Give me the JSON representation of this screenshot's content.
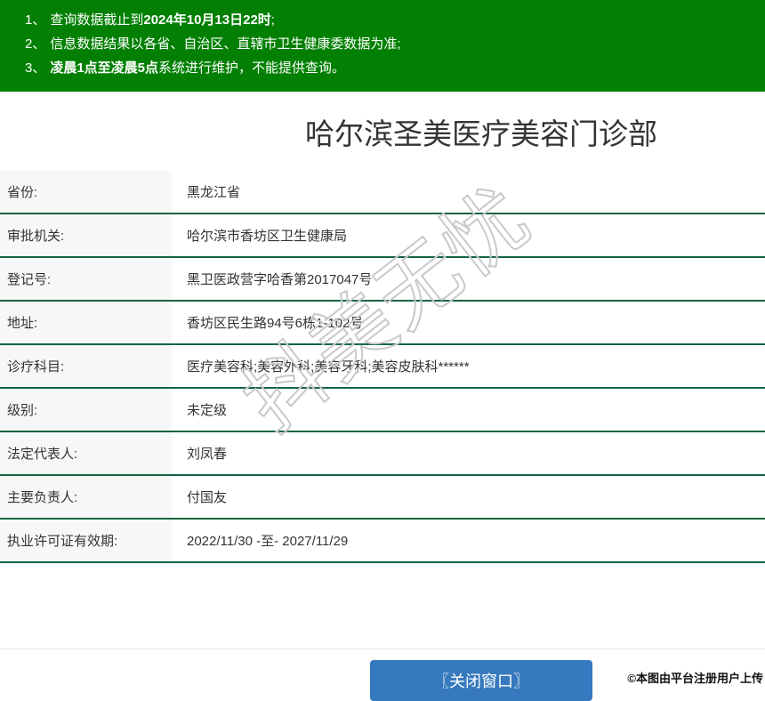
{
  "notice_bar": {
    "items": [
      {
        "num": "1、",
        "pre": "查询数据截止到",
        "bold": "2024年10月13日22时",
        "post": ";"
      },
      {
        "num": "2、",
        "pre": "信息数据结果以各省、自治区、直辖市卫生健康委数据为准;",
        "bold": "",
        "post": ""
      },
      {
        "num": "3、",
        "pre": "",
        "bold": "凌晨1点至凌晨5点",
        "post": "系统进行维护，不能提供查询。"
      }
    ]
  },
  "title": "哈尔滨圣美医疗美容门诊部",
  "table": {
    "rows": [
      {
        "label": "省份:",
        "value": "黑龙江省"
      },
      {
        "label": "审批机关:",
        "value": "哈尔滨市香坊区卫生健康局"
      },
      {
        "label": "登记号:",
        "value": "黑卫医政营字哈香第2017047号"
      },
      {
        "label": "地址:",
        "value": "香坊区民生路94号6栋1-102号"
      },
      {
        "label": "诊疗科目:",
        "value": "医疗美容科;美容外科;美容牙科;美容皮肤科******"
      },
      {
        "label": "级别:",
        "value": "未定级"
      },
      {
        "label": "法定代表人:",
        "value": "刘凤春"
      },
      {
        "label": "主要负责人:",
        "value": "付国友"
      },
      {
        "label": "执业许可证有效期:",
        "value": "2022/11/30 -至- 2027/11/29"
      }
    ]
  },
  "close_button": {
    "label": "〖关闭窗口〗"
  },
  "watermark": {
    "text": "抖美无忧"
  },
  "footer_note": "©本图由平台注册用户上传",
  "colors": {
    "header_green": "#038003",
    "row_line_green": "#136540",
    "label_bg": "#f7f7f7",
    "button_blue": "#3779be",
    "text": "#333333"
  }
}
